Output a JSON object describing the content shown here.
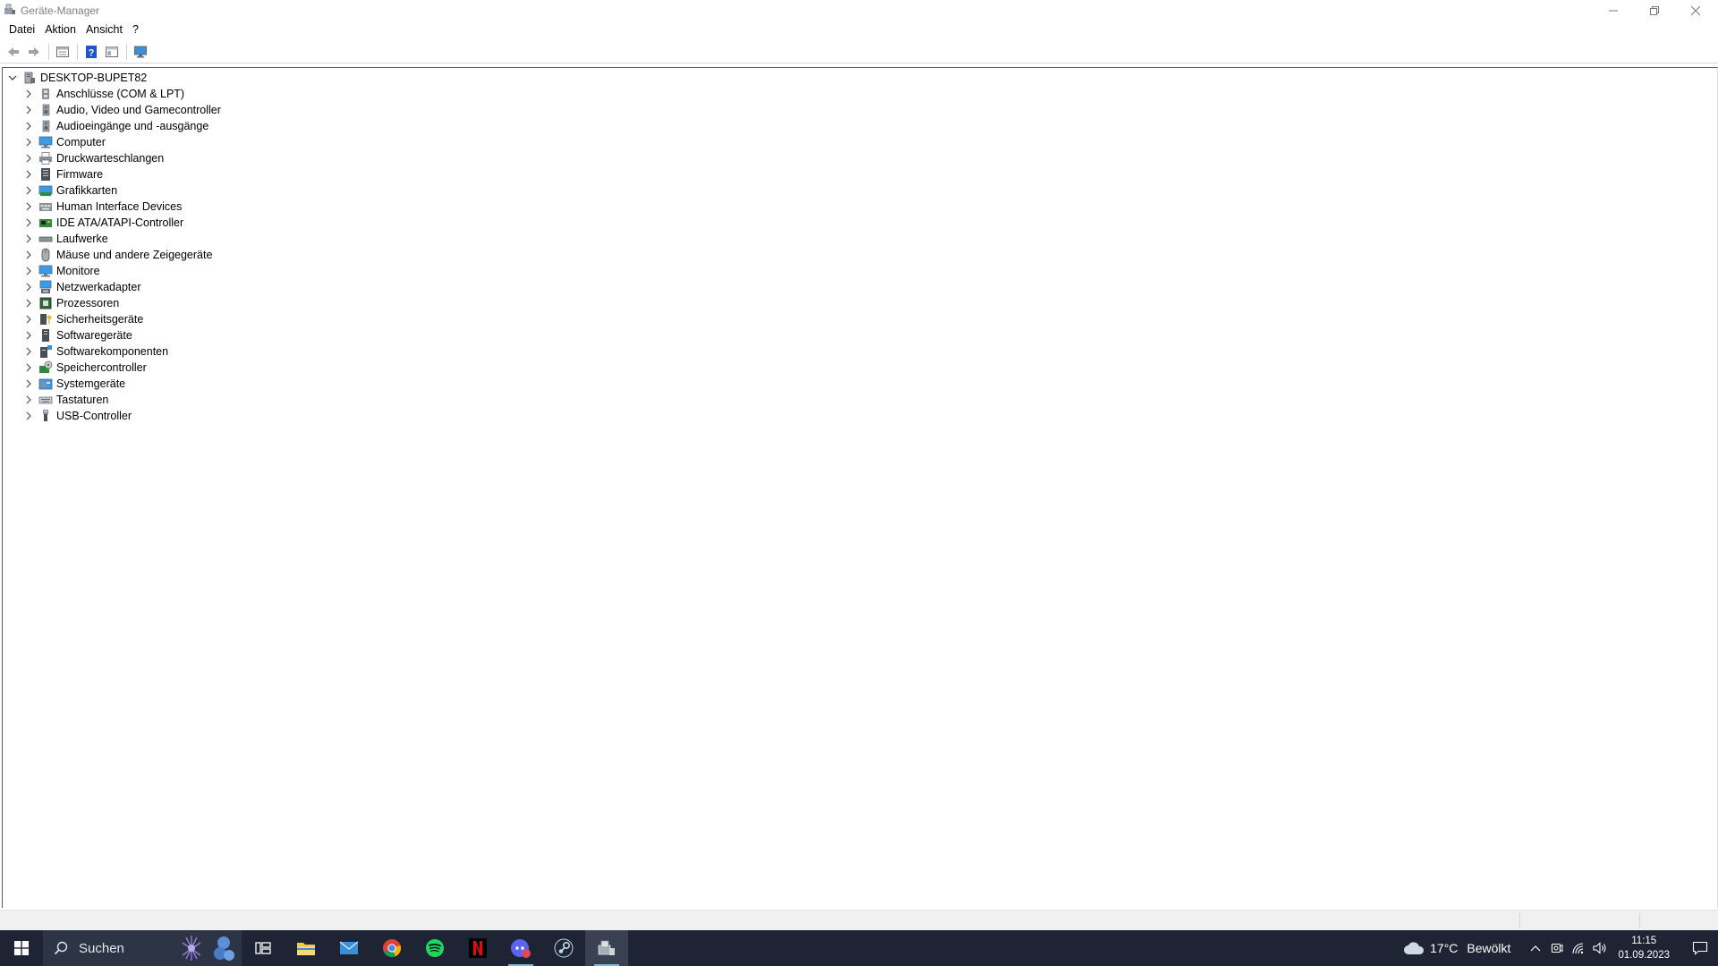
{
  "window": {
    "title": "Geräte-Manager"
  },
  "menubar": {
    "items": [
      "Datei",
      "Aktion",
      "Ansicht",
      "?"
    ]
  },
  "toolbar": {
    "buttons": [
      "back-arrow-icon",
      "forward-arrow-icon",
      "properties-icon",
      "help-icon",
      "view-icon",
      "monitor-icon"
    ]
  },
  "tree": {
    "root": "DESKTOP-BUPET82",
    "items": [
      {
        "label": "Anschlüsse (COM & LPT)",
        "icon": "port-icon"
      },
      {
        "label": "Audio, Video und Gamecontroller",
        "icon": "speaker-icon"
      },
      {
        "label": "Audioeingänge und -ausgänge",
        "icon": "speaker-icon"
      },
      {
        "label": "Computer",
        "icon": "computer-icon"
      },
      {
        "label": "Druckwarteschlangen",
        "icon": "printer-icon"
      },
      {
        "label": "Firmware",
        "icon": "firmware-icon"
      },
      {
        "label": "Grafikkarten",
        "icon": "display-adapter-icon"
      },
      {
        "label": "Human Interface Devices",
        "icon": "hid-icon"
      },
      {
        "label": "IDE ATA/ATAPI-Controller",
        "icon": "ide-controller-icon"
      },
      {
        "label": "Laufwerke",
        "icon": "disk-drive-icon"
      },
      {
        "label": "Mäuse und andere Zeigegeräte",
        "icon": "mouse-icon"
      },
      {
        "label": "Monitore",
        "icon": "monitor-icon"
      },
      {
        "label": "Netzwerkadapter",
        "icon": "network-adapter-icon"
      },
      {
        "label": "Prozessoren",
        "icon": "processor-icon"
      },
      {
        "label": "Sicherheitsgeräte",
        "icon": "security-device-icon"
      },
      {
        "label": "Softwaregeräte",
        "icon": "software-device-icon"
      },
      {
        "label": "Softwarekomponenten",
        "icon": "software-component-icon"
      },
      {
        "label": "Speichercontroller",
        "icon": "storage-controller-icon"
      },
      {
        "label": "Systemgeräte",
        "icon": "system-device-icon"
      },
      {
        "label": "Tastaturen",
        "icon": "keyboard-icon"
      },
      {
        "label": "USB-Controller",
        "icon": "usb-icon"
      }
    ]
  },
  "taskbar": {
    "search_label": "Suchen",
    "apps": [
      "task-view-icon",
      "file-explorer-icon",
      "mail-icon",
      "chrome-icon",
      "spotify-icon",
      "netflix-icon",
      "discord-icon",
      "steam-icon",
      "device-manager-icon"
    ],
    "weather": {
      "temp": "17°C",
      "condition": "Bewölkt"
    },
    "clock": {
      "time": "11:15",
      "date": "01.09.2023"
    }
  },
  "colors": {
    "taskbar_bg": "#1e2433",
    "accent": "#76b9ed"
  }
}
